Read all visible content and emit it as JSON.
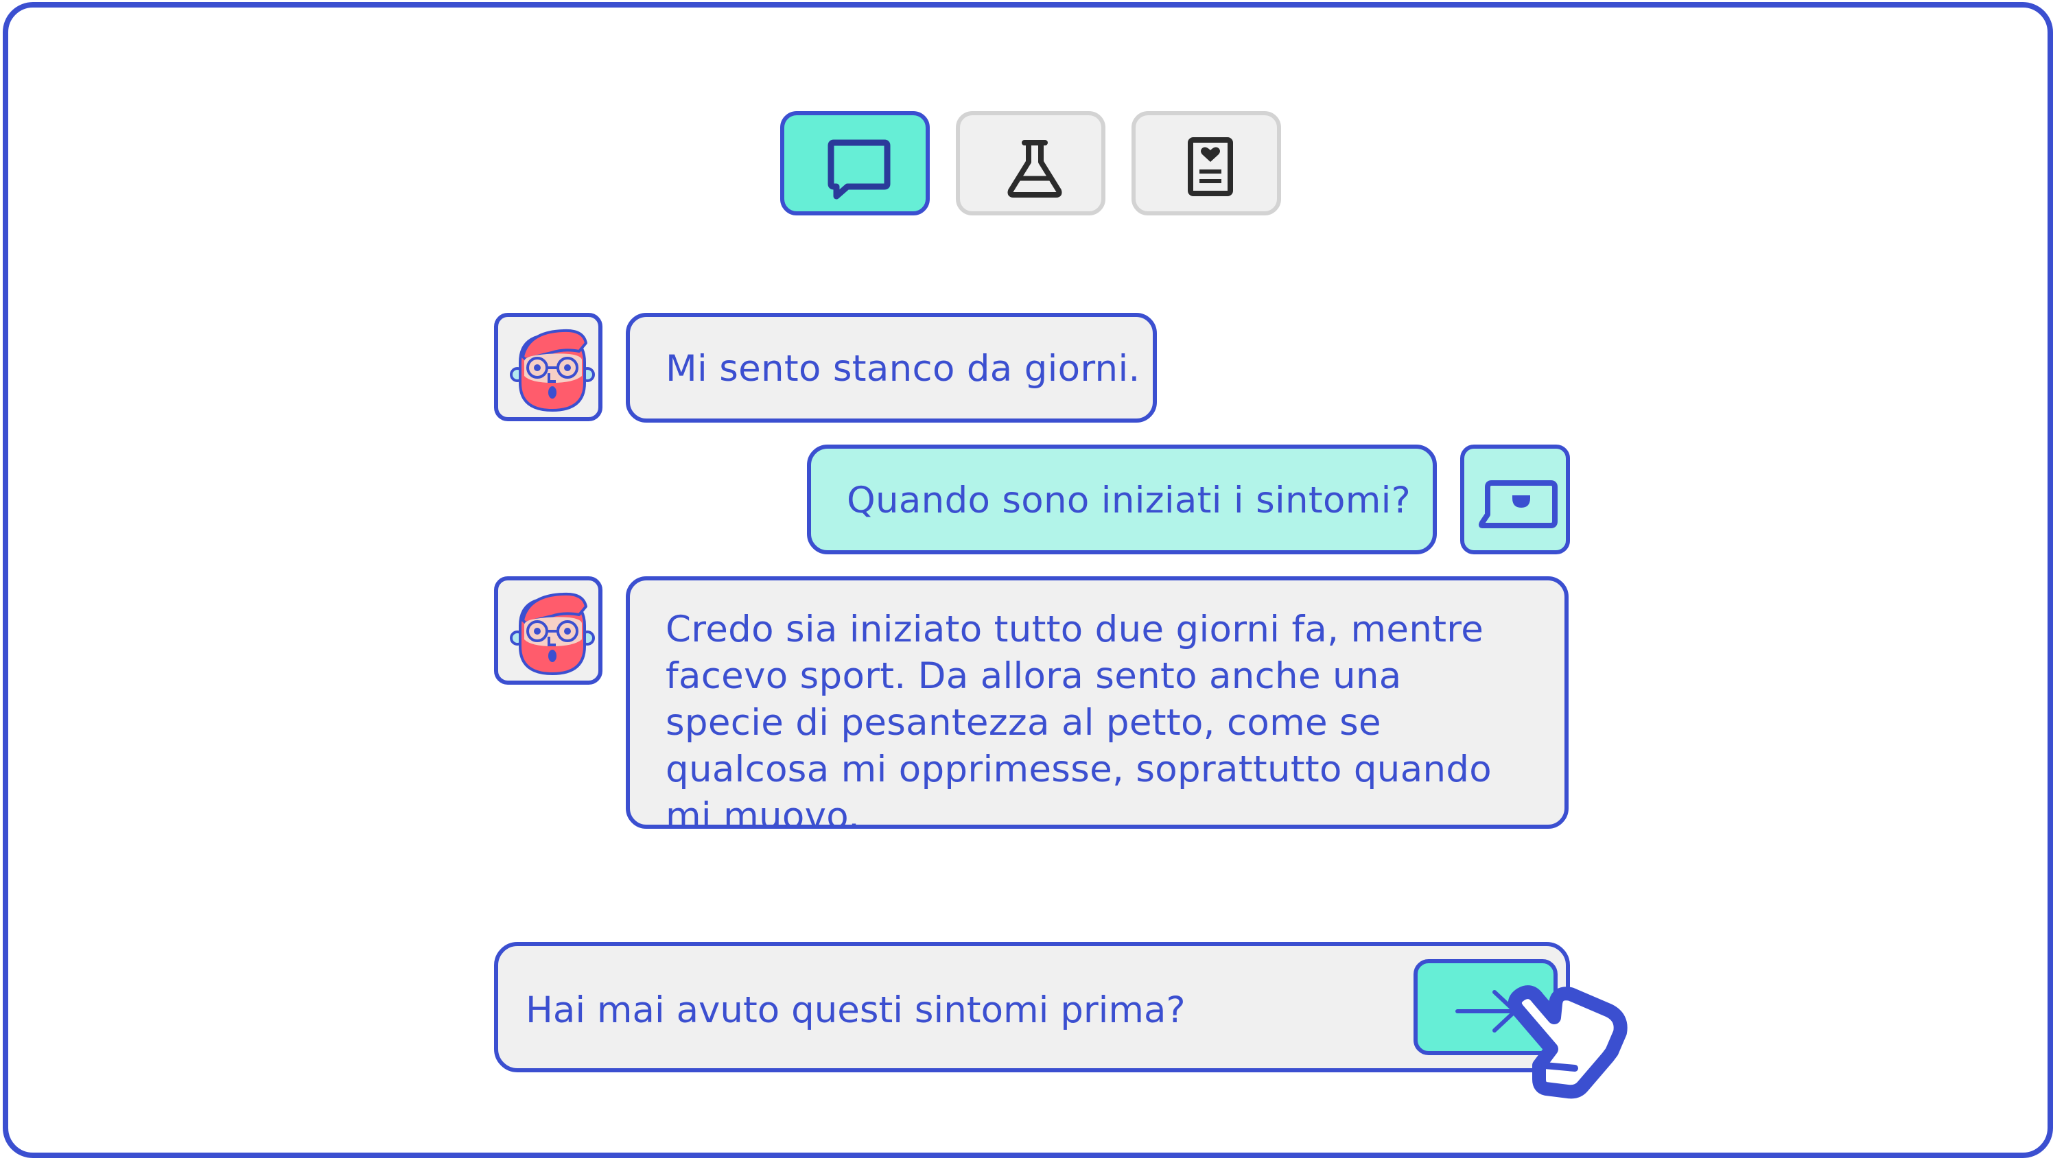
{
  "tabs": [
    {
      "name": "chat",
      "icon": "chat-bubble-icon",
      "active": true
    },
    {
      "name": "lab",
      "icon": "flask-icon",
      "active": false
    },
    {
      "name": "record",
      "icon": "medical-record-icon",
      "active": false
    }
  ],
  "messages": [
    {
      "from": "patient",
      "text": "Mi sento stanco da giorni."
    },
    {
      "from": "doctor",
      "text": "Quando sono iniziati i sintomi?"
    },
    {
      "from": "patient",
      "text": "Credo sia iniziato tutto due giorni fa, mentre facevo sport. Da allora sento anche una specie di pesantezza al petto, come se qualcosa mi opprimesse, soprattutto quando mi muovo."
    }
  ],
  "composer": {
    "value": "Hai mai avuto questi sintomi prima?"
  },
  "colors": {
    "accent": "#3b4fd0",
    "active_tab": "#66eed6",
    "doctor_bubble": "#b2f4e9",
    "patient_bubble": "#f0f0f0",
    "avatar_face": "#ff5c6c"
  }
}
